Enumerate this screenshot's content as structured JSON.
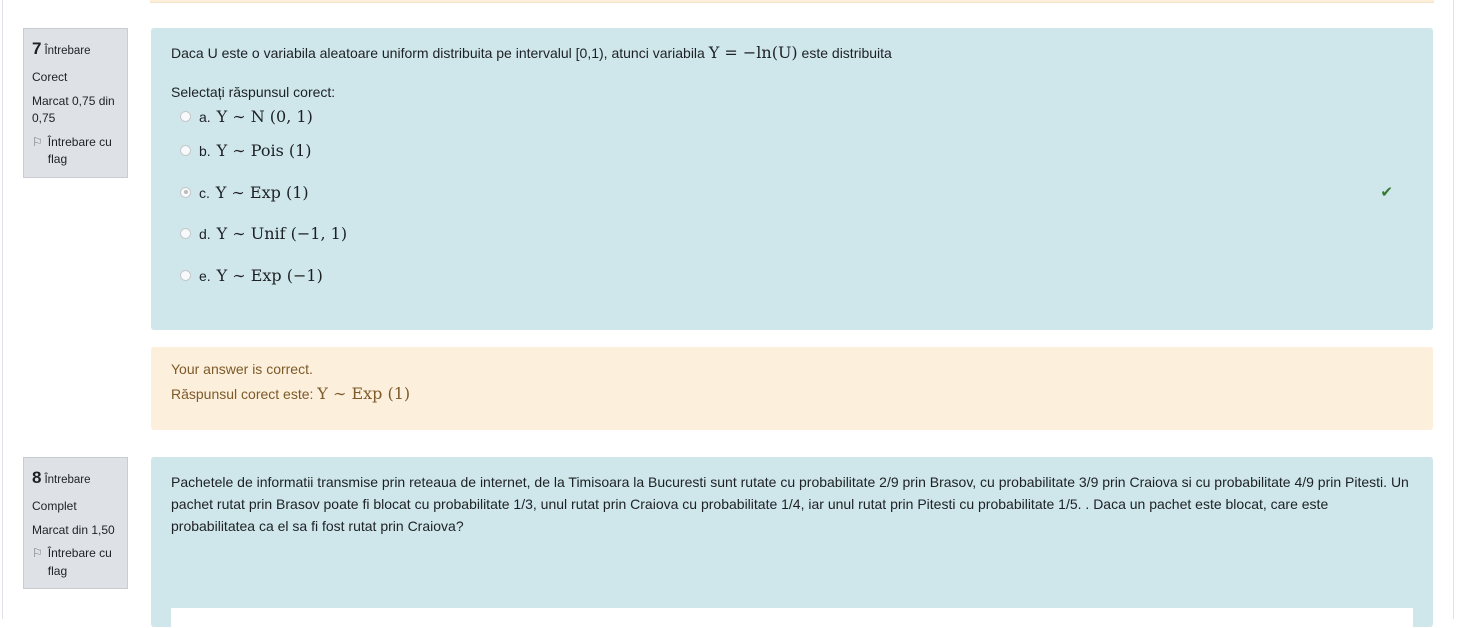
{
  "q7": {
    "number": "7",
    "word": "Întrebare",
    "state": "Corect",
    "grade": "Marcat 0,75 din 0,75",
    "flag_label": "Întrebare cu flag",
    "text_before": "Daca U este o variabila aleatoare uniform distribuita pe intervalul [0,1), atunci variabila ",
    "text_math": "Y = −ln(U)",
    "text_after": " este distribuita",
    "prompt": "Selectați răspunsul corect:",
    "answers": [
      {
        "label": "a.",
        "math": "Y ∼ N (0, 1)",
        "checked": false
      },
      {
        "label": "b.",
        "math": "Y ∼ Pois (1)",
        "checked": false
      },
      {
        "label": "c.",
        "math": "Y ∼ Exp (1)",
        "checked": true
      },
      {
        "label": "d.",
        "math": "Y ∼ Unif (−1, 1)",
        "checked": false
      },
      {
        "label": "e.",
        "math": "Y ∼ Exp (−1)",
        "checked": false
      }
    ],
    "check_icon": "✔",
    "feedback_line1": "Your answer is correct.",
    "feedback_prefix": "Răspunsul corect este: ",
    "feedback_math": "Y ∼ Exp (1)"
  },
  "q8": {
    "number": "8",
    "word": "Întrebare",
    "state": "Complet",
    "grade": "Marcat din 1,50",
    "flag_label": "Întrebare cu flag",
    "text": "Pachetele de informatii transmise prin reteaua de internet, de la Timisoara la Bucuresti sunt rutate cu probabilitate 2/9 prin Brasov, cu probabilitate 3/9 prin Craiova si cu probabilitate 4/9 prin Pitesti. Un pachet rutat prin Brasov poate fi blocat cu probabilitate 1/3, unul rutat prin Craiova cu probabilitate 1/4, iar unul rutat prin Pitesti cu probabilitate 1/5. . Daca un pachet  este blocat, care este probabilitatea ca el sa fi fost rutat prin Craiova?"
  },
  "colors": {
    "question_bg": "#cfe7ea",
    "feedback_bg": "#fcefdc",
    "feedback_text": "#7d5a29",
    "info_bg": "#dee2e6",
    "check_green": "#357a32"
  }
}
